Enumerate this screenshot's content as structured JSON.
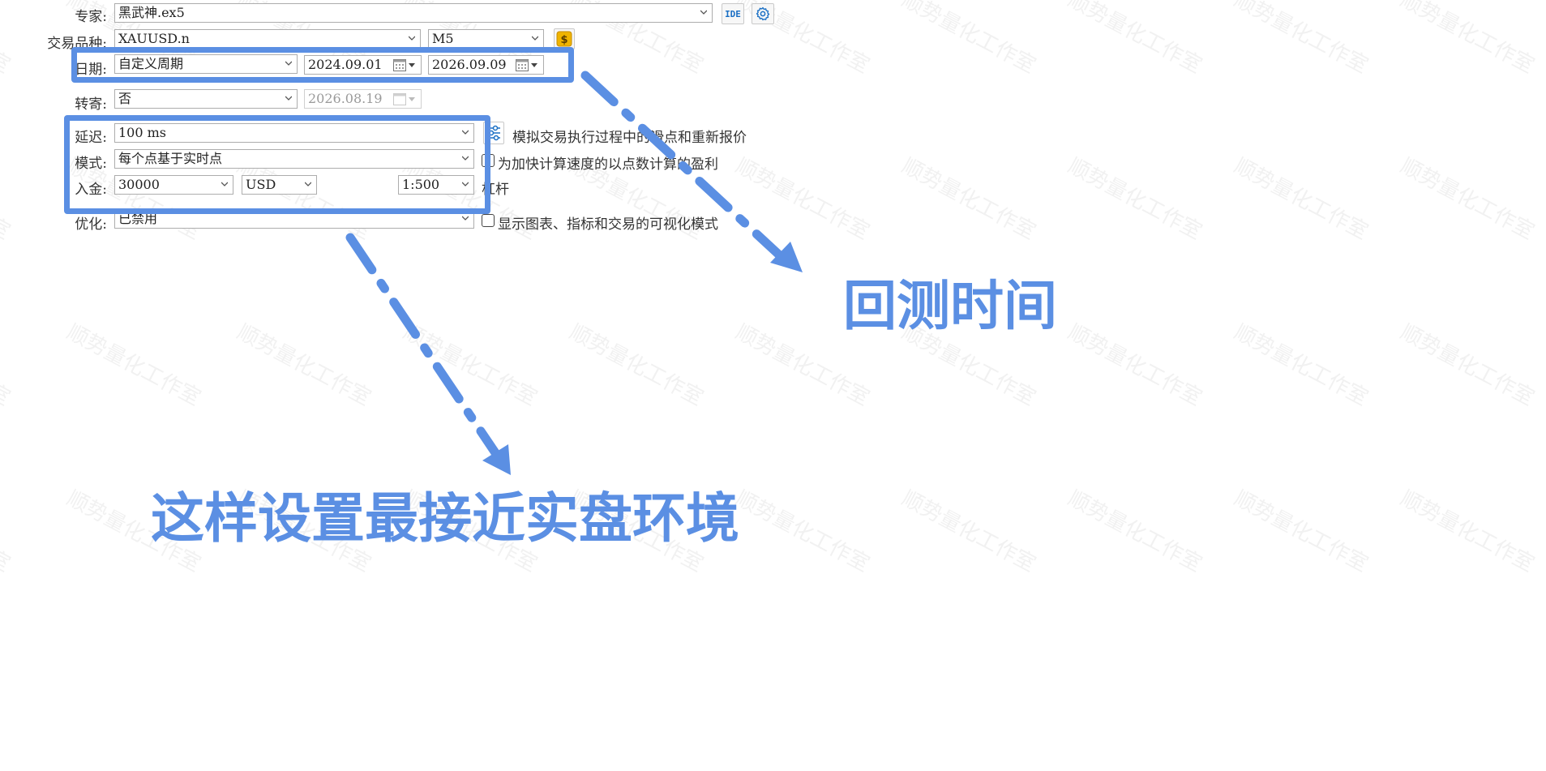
{
  "form": {
    "expert": {
      "label": "专家:",
      "value": "黑武神.ex5"
    },
    "ide_label": "IDE",
    "symbol": {
      "label": "交易品种:",
      "value": "XAUUSD.n",
      "timeframe": "M5",
      "currency_icon": "dollar-icon"
    },
    "date": {
      "label": "日期:",
      "period": "自定义周期",
      "from": "2024.09.01",
      "to": "2026.09.09"
    },
    "forward": {
      "label": "转寄:",
      "value": "否",
      "date": "2026.08.19"
    },
    "delay": {
      "label": "延迟:",
      "value": "100 ms",
      "note": "模拟交易执行过程中的滑点和重新报价"
    },
    "model": {
      "label": "模式:",
      "value": "每个点基于实时点",
      "checkbox_text": "为加快计算速度的以点数计算的盈利"
    },
    "deposit": {
      "label": "入金:",
      "amount": "30000",
      "currency": "USD",
      "leverage": "1:500",
      "leverage_label": "杠杆"
    },
    "optimization": {
      "label": "优化:",
      "value": "已禁用",
      "checkbox_text": "显示图表、指标和交易的可视化模式"
    }
  },
  "annotations": {
    "backtest_time": "回测时间",
    "realistic_setup": "这样设置最接近实盘环境"
  },
  "watermark": "顺势量化工作室",
  "colors": {
    "highlight": "#5b8fe3",
    "currency_button": "#f0b400",
    "settings_icon": "#1a6fc4"
  }
}
